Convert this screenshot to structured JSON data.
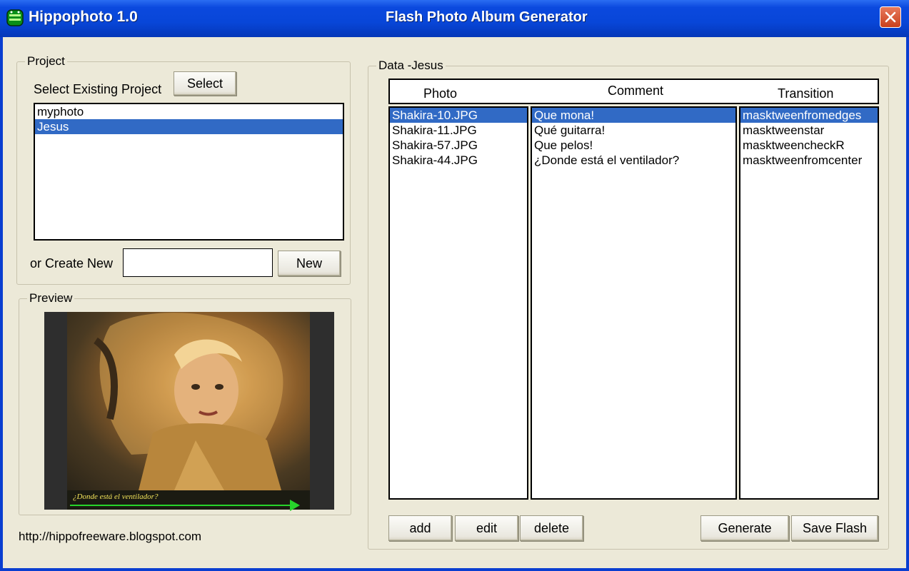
{
  "window": {
    "title": "Hippophoto 1.0",
    "subtitle": "Flash Photo Album Generator"
  },
  "project": {
    "legend": "Project",
    "select_label": "Select Existing Project",
    "select_button": "Select",
    "items": [
      {
        "label": "myphoto",
        "selected": false
      },
      {
        "label": "Jesus",
        "selected": true
      }
    ],
    "create_label": "or Create New",
    "new_name_value": "",
    "new_button": "New"
  },
  "preview": {
    "legend": "Preview",
    "caption": "¿Donde está el ventilador?"
  },
  "footer": {
    "url": "http://hippofreeware.blogspot.com"
  },
  "data": {
    "legend": "Data -Jesus",
    "columns": {
      "photo": "Photo",
      "comment": "Comment",
      "transition": "Transition"
    },
    "photos": [
      "Shakira-10.JPG",
      "Shakira-11.JPG",
      "Shakira-57.JPG",
      "Shakira-44.JPG"
    ],
    "comments": [
      "Que mona!",
      "Qué guitarra!",
      "Que pelos!",
      "¿Donde está el ventilador?"
    ],
    "transitions": [
      "masktweenfromedges",
      "masktweenstar",
      "masktweencheckR",
      "masktweenfromcenter"
    ],
    "selected_row": 0,
    "buttons": {
      "add": "add",
      "edit": "edit",
      "delete": "delete",
      "generate": "Generate",
      "save_flash": "Save Flash"
    }
  },
  "colors": {
    "titlebar": "#0846d8",
    "selection": "#316ac5",
    "client_bg": "#ece9d8",
    "close_button": "#c9401d"
  }
}
